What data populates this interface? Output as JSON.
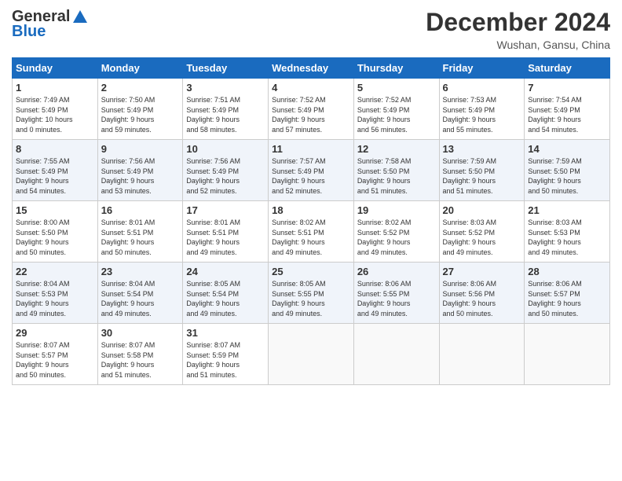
{
  "header": {
    "logo_general": "General",
    "logo_blue": "Blue",
    "month_title": "December 2024",
    "location": "Wushan, Gansu, China"
  },
  "weekdays": [
    "Sunday",
    "Monday",
    "Tuesday",
    "Wednesday",
    "Thursday",
    "Friday",
    "Saturday"
  ],
  "weeks": [
    [
      {
        "day": "1",
        "sunrise": "7:49 AM",
        "sunset": "5:49 PM",
        "daylight_hours": "10",
        "daylight_minutes": "0"
      },
      {
        "day": "2",
        "sunrise": "7:50 AM",
        "sunset": "5:49 PM",
        "daylight_hours": "9",
        "daylight_minutes": "59"
      },
      {
        "day": "3",
        "sunrise": "7:51 AM",
        "sunset": "5:49 PM",
        "daylight_hours": "9",
        "daylight_minutes": "58"
      },
      {
        "day": "4",
        "sunrise": "7:52 AM",
        "sunset": "5:49 PM",
        "daylight_hours": "9",
        "daylight_minutes": "57"
      },
      {
        "day": "5",
        "sunrise": "7:52 AM",
        "sunset": "5:49 PM",
        "daylight_hours": "9",
        "daylight_minutes": "56"
      },
      {
        "day": "6",
        "sunrise": "7:53 AM",
        "sunset": "5:49 PM",
        "daylight_hours": "9",
        "daylight_minutes": "55"
      },
      {
        "day": "7",
        "sunrise": "7:54 AM",
        "sunset": "5:49 PM",
        "daylight_hours": "9",
        "daylight_minutes": "54"
      }
    ],
    [
      {
        "day": "8",
        "sunrise": "7:55 AM",
        "sunset": "5:49 PM",
        "daylight_hours": "9",
        "daylight_minutes": "54"
      },
      {
        "day": "9",
        "sunrise": "7:56 AM",
        "sunset": "5:49 PM",
        "daylight_hours": "9",
        "daylight_minutes": "53"
      },
      {
        "day": "10",
        "sunrise": "7:56 AM",
        "sunset": "5:49 PM",
        "daylight_hours": "9",
        "daylight_minutes": "52"
      },
      {
        "day": "11",
        "sunrise": "7:57 AM",
        "sunset": "5:49 PM",
        "daylight_hours": "9",
        "daylight_minutes": "52"
      },
      {
        "day": "12",
        "sunrise": "7:58 AM",
        "sunset": "5:50 PM",
        "daylight_hours": "9",
        "daylight_minutes": "51"
      },
      {
        "day": "13",
        "sunrise": "7:59 AM",
        "sunset": "5:50 PM",
        "daylight_hours": "9",
        "daylight_minutes": "51"
      },
      {
        "day": "14",
        "sunrise": "7:59 AM",
        "sunset": "5:50 PM",
        "daylight_hours": "9",
        "daylight_minutes": "50"
      }
    ],
    [
      {
        "day": "15",
        "sunrise": "8:00 AM",
        "sunset": "5:50 PM",
        "daylight_hours": "9",
        "daylight_minutes": "50"
      },
      {
        "day": "16",
        "sunrise": "8:01 AM",
        "sunset": "5:51 PM",
        "daylight_hours": "9",
        "daylight_minutes": "50"
      },
      {
        "day": "17",
        "sunrise": "8:01 AM",
        "sunset": "5:51 PM",
        "daylight_hours": "9",
        "daylight_minutes": "49"
      },
      {
        "day": "18",
        "sunrise": "8:02 AM",
        "sunset": "5:51 PM",
        "daylight_hours": "9",
        "daylight_minutes": "49"
      },
      {
        "day": "19",
        "sunrise": "8:02 AM",
        "sunset": "5:52 PM",
        "daylight_hours": "9",
        "daylight_minutes": "49"
      },
      {
        "day": "20",
        "sunrise": "8:03 AM",
        "sunset": "5:52 PM",
        "daylight_hours": "9",
        "daylight_minutes": "49"
      },
      {
        "day": "21",
        "sunrise": "8:03 AM",
        "sunset": "5:53 PM",
        "daylight_hours": "9",
        "daylight_minutes": "49"
      }
    ],
    [
      {
        "day": "22",
        "sunrise": "8:04 AM",
        "sunset": "5:53 PM",
        "daylight_hours": "9",
        "daylight_minutes": "49"
      },
      {
        "day": "23",
        "sunrise": "8:04 AM",
        "sunset": "5:54 PM",
        "daylight_hours": "9",
        "daylight_minutes": "49"
      },
      {
        "day": "24",
        "sunrise": "8:05 AM",
        "sunset": "5:54 PM",
        "daylight_hours": "9",
        "daylight_minutes": "49"
      },
      {
        "day": "25",
        "sunrise": "8:05 AM",
        "sunset": "5:55 PM",
        "daylight_hours": "9",
        "daylight_minutes": "49"
      },
      {
        "day": "26",
        "sunrise": "8:06 AM",
        "sunset": "5:55 PM",
        "daylight_hours": "9",
        "daylight_minutes": "49"
      },
      {
        "day": "27",
        "sunrise": "8:06 AM",
        "sunset": "5:56 PM",
        "daylight_hours": "9",
        "daylight_minutes": "50"
      },
      {
        "day": "28",
        "sunrise": "8:06 AM",
        "sunset": "5:57 PM",
        "daylight_hours": "9",
        "daylight_minutes": "50"
      }
    ],
    [
      {
        "day": "29",
        "sunrise": "8:07 AM",
        "sunset": "5:57 PM",
        "daylight_hours": "9",
        "daylight_minutes": "50"
      },
      {
        "day": "30",
        "sunrise": "8:07 AM",
        "sunset": "5:58 PM",
        "daylight_hours": "9",
        "daylight_minutes": "51"
      },
      {
        "day": "31",
        "sunrise": "8:07 AM",
        "sunset": "5:59 PM",
        "daylight_hours": "9",
        "daylight_minutes": "51"
      },
      null,
      null,
      null,
      null
    ]
  ]
}
